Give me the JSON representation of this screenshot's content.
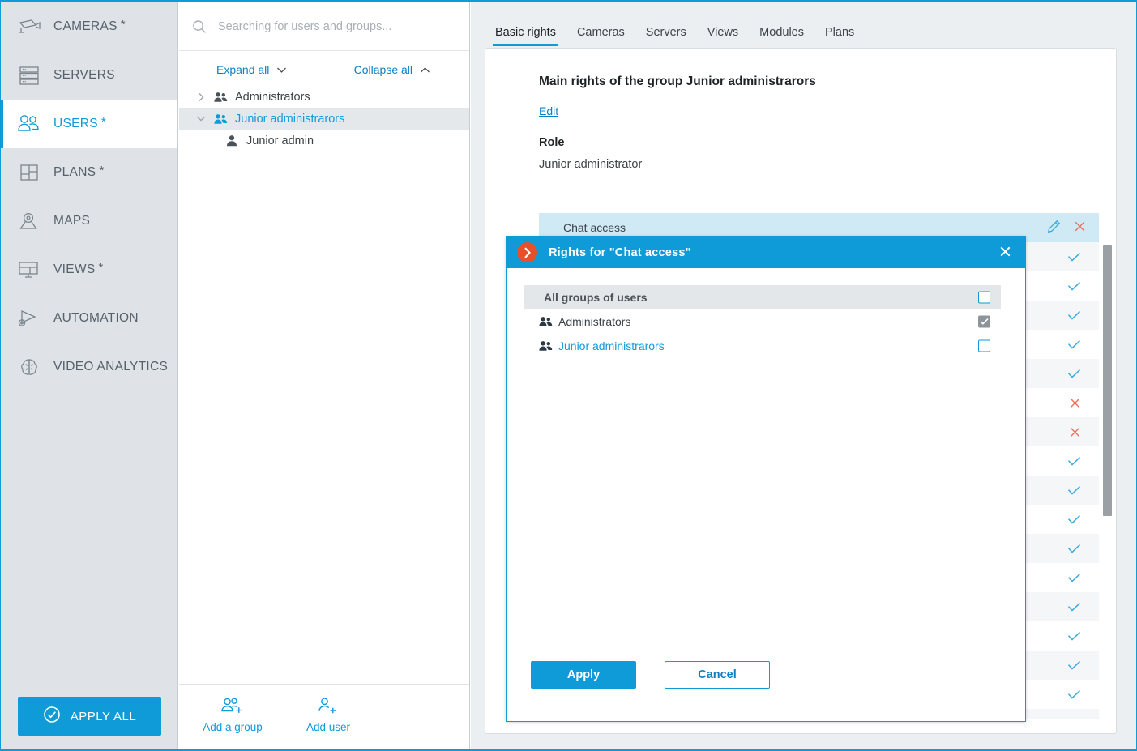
{
  "colors": {
    "accent": "#0e9bd8",
    "link": "#0e7fc4",
    "sidebar_bg": "#dfe3e7",
    "main_bg": "#eceff1",
    "badge_orange": "#e8502a",
    "row_highlight": "#cfe9f5",
    "cross_red": "#e8705c",
    "check_blue": "#3ba9dd"
  },
  "sidebar": {
    "items": [
      {
        "label": "CAMERAS",
        "icon": "camera-icon",
        "modified": "*",
        "active": false
      },
      {
        "label": "SERVERS",
        "icon": "server-icon",
        "modified": "",
        "active": false
      },
      {
        "label": "USERS",
        "icon": "users-icon",
        "modified": "*",
        "active": true
      },
      {
        "label": "PLANS",
        "icon": "plans-icon",
        "modified": "*",
        "active": false
      },
      {
        "label": "MAPS",
        "icon": "map-pin-icon",
        "modified": "",
        "active": false
      },
      {
        "label": "VIEWS",
        "icon": "views-grid-icon",
        "modified": "*",
        "active": false
      },
      {
        "label": "AUTOMATION",
        "icon": "automation-icon",
        "modified": "",
        "active": false
      },
      {
        "label": "VIDEO ANALYTICS",
        "icon": "brain-icon",
        "modified": "",
        "active": false
      }
    ],
    "apply_all_label": "APPLY ALL",
    "apply_all_icon": "check-circle-icon"
  },
  "tree_panel": {
    "search": {
      "placeholder": "Searching for users and groups...",
      "value": "",
      "icon": "search-icon"
    },
    "expand_all_label": "Expand all",
    "collapse_all_label": "Collapse all",
    "nodes": [
      {
        "label": "Administrators",
        "icon": "group-icon",
        "caret": "collapsed",
        "depth": 0,
        "selected": false
      },
      {
        "label": "Junior administrarors",
        "icon": "group-icon",
        "caret": "expanded",
        "depth": 0,
        "selected": true
      },
      {
        "label": "Junior admin",
        "icon": "user-icon",
        "caret": "none",
        "depth": 1,
        "selected": false
      }
    ],
    "footer": {
      "add_group_label": "Add a group",
      "add_group_icon": "add-group-icon",
      "add_user_label": "Add user",
      "add_user_icon": "add-user-icon"
    }
  },
  "main": {
    "tabs": [
      {
        "label": "Basic rights",
        "active": true
      },
      {
        "label": "Cameras",
        "active": false
      },
      {
        "label": "Servers",
        "active": false
      },
      {
        "label": "Views",
        "active": false
      },
      {
        "label": "Modules",
        "active": false
      },
      {
        "label": "Plans",
        "active": false
      }
    ],
    "card": {
      "heading": "Main rights of the group Junior administrarors",
      "edit_label": "Edit",
      "role_label": "Role",
      "role_value": "Junior administrator"
    },
    "rights": [
      {
        "label": "Chat access",
        "state": "cross",
        "highlighted": true,
        "has_actions": true
      },
      {
        "label": "",
        "state": "check",
        "highlighted": false,
        "has_actions": false
      },
      {
        "label": "",
        "state": "check",
        "highlighted": false,
        "has_actions": false
      },
      {
        "label": "",
        "state": "check",
        "highlighted": false,
        "has_actions": false
      },
      {
        "label": "",
        "state": "check",
        "highlighted": false,
        "has_actions": false
      },
      {
        "label": "",
        "state": "check",
        "highlighted": false,
        "has_actions": false
      },
      {
        "label": "",
        "state": "cross",
        "highlighted": false,
        "has_actions": false
      },
      {
        "label": "",
        "state": "cross",
        "highlighted": false,
        "has_actions": false
      },
      {
        "label": "",
        "state": "check",
        "highlighted": false,
        "has_actions": false
      },
      {
        "label": "",
        "state": "check",
        "highlighted": false,
        "has_actions": false
      },
      {
        "label": "",
        "state": "check",
        "highlighted": false,
        "has_actions": false
      },
      {
        "label": "",
        "state": "check",
        "highlighted": false,
        "has_actions": false
      },
      {
        "label": "",
        "state": "check",
        "highlighted": false,
        "has_actions": false
      },
      {
        "label": "",
        "state": "check",
        "highlighted": false,
        "has_actions": false
      },
      {
        "label": "",
        "state": "check",
        "highlighted": false,
        "has_actions": false
      },
      {
        "label": "",
        "state": "check",
        "highlighted": false,
        "has_actions": false
      },
      {
        "label": "",
        "state": "check",
        "highlighted": false,
        "has_actions": false
      },
      {
        "label": "",
        "state": "cross",
        "highlighted": false,
        "has_actions": false
      }
    ],
    "row_actions": {
      "edit_icon": "pencil-icon",
      "remove_icon": "cross-icon"
    }
  },
  "modal": {
    "title": "Rights for \"Chat access\"",
    "badge_icon": "chevron-right-circle-icon",
    "close_icon": "close-icon",
    "list_header": "All groups of users",
    "list_header_checkbox": "unchecked",
    "rows": [
      {
        "label": "Administrators",
        "icon": "group-icon",
        "checkbox": "checked-disabled",
        "is_link": false
      },
      {
        "label": "Junior administrarors",
        "icon": "group-icon",
        "checkbox": "unchecked",
        "is_link": true
      }
    ],
    "apply_label": "Apply",
    "cancel_label": "Cancel"
  }
}
